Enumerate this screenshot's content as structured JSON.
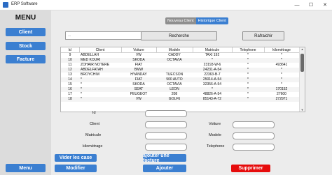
{
  "window": {
    "title": "ERP Software",
    "minimize_label": "—",
    "maximize_label": "☐",
    "close_label": "✕"
  },
  "sidebar": {
    "title": "MENU",
    "items": [
      {
        "label": "Client"
      },
      {
        "label": "Stock"
      },
      {
        "label": "Facture"
      }
    ],
    "menu_button": "Menu"
  },
  "segmented": {
    "nouveau_label": "Nouveau Client",
    "historique_label": "Historique Client",
    "active": "Historique Client"
  },
  "search": {
    "placeholder": "...",
    "value": "",
    "button_label": "Recherche",
    "refresh_label": "Rafraichir"
  },
  "table": {
    "columns": [
      "Id",
      "Client",
      "Voiture",
      "Modele",
      "Matricule",
      "Telephone",
      "kilométrage"
    ],
    "rows": [
      [
        "9",
        "ABDELLAH",
        "VW",
        "CADDY",
        "TAXI 192",
        "*",
        "*"
      ],
      [
        "10",
        "MED KOURI",
        "SKODA",
        "OCTAVIA",
        "*",
        "*",
        "*"
      ],
      [
        "11",
        "ZOHAIR NOTERE",
        "FIAT",
        "",
        "23193-W-6",
        "*",
        "493641"
      ],
      [
        "12",
        "ABDELFATAH",
        "BMW",
        "",
        "24231-A-54",
        "*",
        "*"
      ],
      [
        "13",
        "BROYCHIM",
        "HYANDAY",
        "TUECSON",
        "22363-B-7",
        "*",
        "*"
      ],
      [
        "14",
        "*",
        "FIAT",
        "500 AUTO",
        "25014-A-54",
        "*",
        "*"
      ],
      [
        "15",
        "*",
        "SKODA",
        "OCTAVIA",
        "32356-A-54",
        "*",
        "*"
      ],
      [
        "16",
        "*",
        "SEAT",
        "LEON",
        "*",
        "*",
        "170152"
      ],
      [
        "17",
        "*",
        "PEUGEOT",
        "208",
        "48826-A-54",
        "*",
        "27600"
      ],
      [
        "18",
        "*",
        "VW",
        "GOLF6",
        "85143-A-72",
        "*",
        "272971"
      ]
    ]
  },
  "form": {
    "id_label": "Id",
    "id_value": "",
    "client_label": "Client",
    "client_value": "",
    "voiture_label": "Voiture",
    "voiture_value": "",
    "matricule_label": "Matricule",
    "matricule_value": "",
    "modele_label": "Modele",
    "modele_value": "",
    "kilometrage_label": "kilométrage",
    "kilometrage_value": "",
    "telephone_label": "Telephone",
    "telephone_value": ""
  },
  "actions": {
    "vider_label": "Vider les case",
    "ajouter_facture_label": "ajouter une facture",
    "modifier_label": "Modifier",
    "ajouter_label": "Ajouter",
    "supprimer_label": "Supprimer"
  },
  "colors": {
    "accent": "#3b7fd1",
    "danger": "#e60c0c",
    "inactive_tab": "#8f8f8f"
  }
}
